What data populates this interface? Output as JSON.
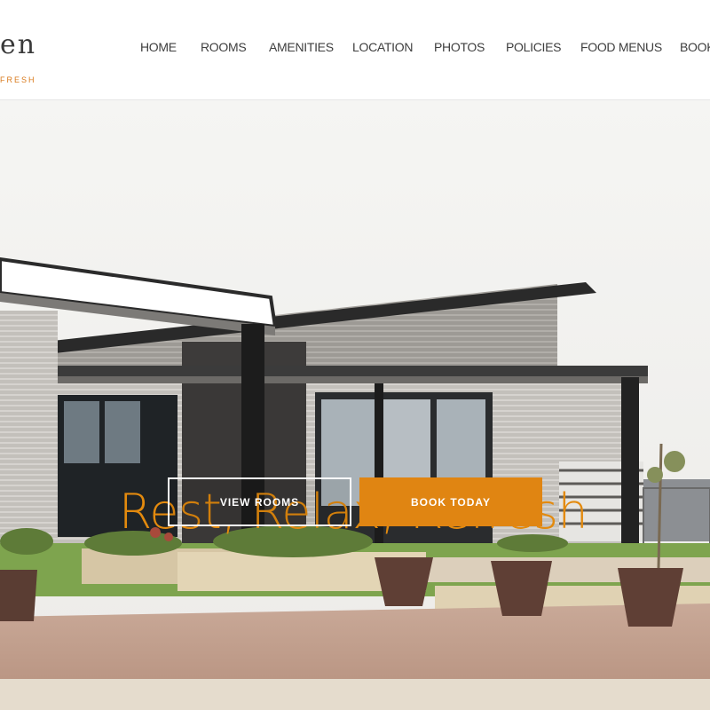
{
  "brand": {
    "logo_text": "en",
    "tagline": "FRESH"
  },
  "nav": {
    "items": [
      {
        "label": "HOME"
      },
      {
        "label": "ROOMS"
      },
      {
        "label": "AMENITIES"
      },
      {
        "label": "LOCATION"
      },
      {
        "label": "PHOTOS"
      },
      {
        "label": "POLICIES"
      },
      {
        "label": "FOOD MENUS"
      },
      {
        "label": "BOOK"
      }
    ]
  },
  "hero": {
    "headline": "Rest, Relax, Refresh",
    "primary_button": "VIEW ROOMS",
    "secondary_button": "BOOK TODAY"
  },
  "colors": {
    "accent": "#e08512",
    "headline": "#e38a0e",
    "nav_text": "#3e3e3e"
  }
}
